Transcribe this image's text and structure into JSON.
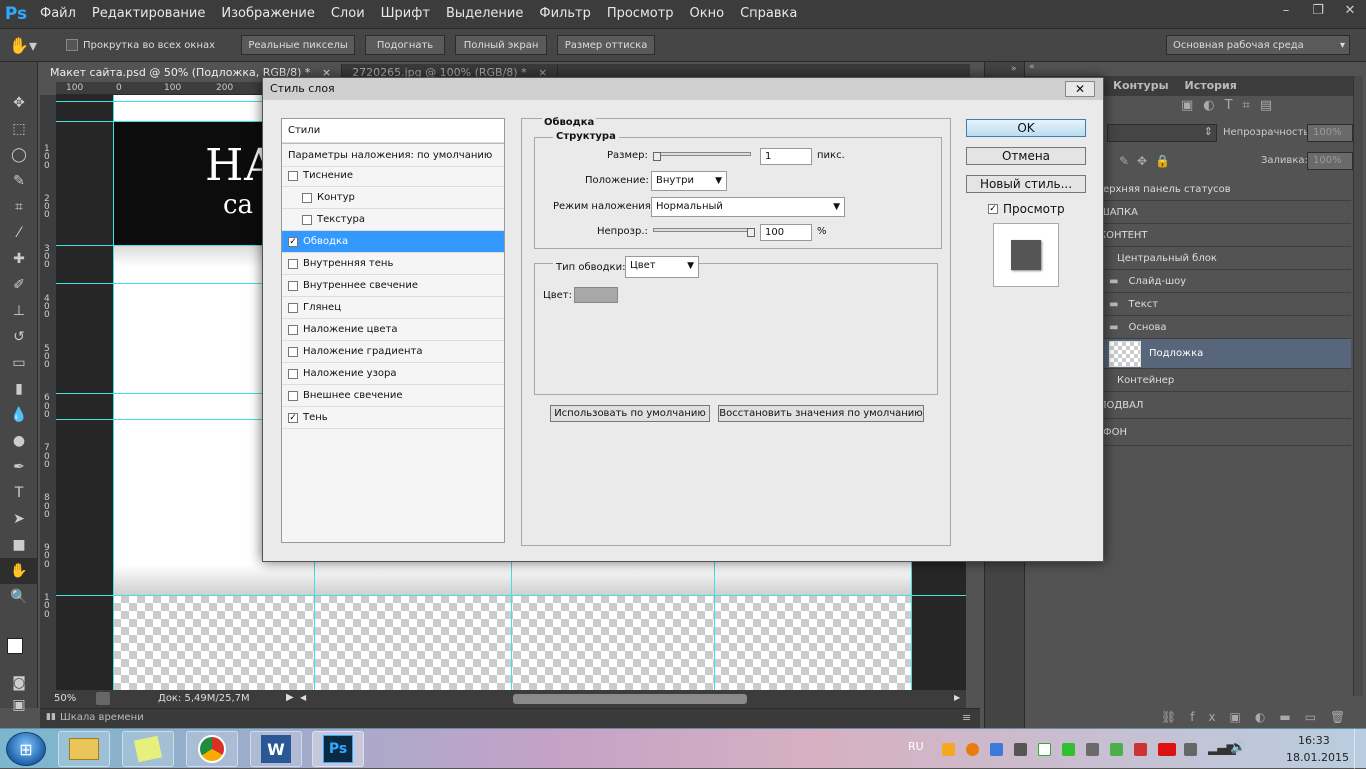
{
  "menubar": {
    "logo": "Ps",
    "items": [
      "Файл",
      "Редактирование",
      "Изображение",
      "Слои",
      "Шрифт",
      "Выделение",
      "Фильтр",
      "Просмотр",
      "Окно",
      "Справка"
    ],
    "window_controls": [
      "–",
      "❐",
      "✕"
    ]
  },
  "optionsbar": {
    "scroll_all_label": "Прокрутка во всех окнах",
    "actual_pixels": "Реальные пикселы",
    "fit": "Подогнать",
    "full_screen": "Полный экран",
    "print_size": "Размер оттиска",
    "workspace": "Основная рабочая среда"
  },
  "tools": [
    "move-icon",
    "marquee-icon",
    "lasso-icon",
    "quick-select-icon",
    "crop-icon",
    "eyedropper-icon",
    "healing-icon",
    "brush-icon",
    "stamp-icon",
    "history-brush-icon",
    "eraser-icon",
    "gradient-icon",
    "blur-icon",
    "dodge-icon",
    "pen-icon",
    "type-icon",
    "path-select-icon",
    "shape-icon",
    "hand-icon",
    "zoom-icon"
  ],
  "document": {
    "tabs": [
      "Макет сайта.psd @ 50% (Подложка, RGB/8) *",
      "2720265.jpg @ 100% (RGB/8) *"
    ],
    "ruler_h": [
      "100",
      "0",
      "100",
      "200"
    ],
    "ruler_v": [
      "1",
      "0",
      "0",
      "2",
      "0",
      "0",
      "3",
      "0",
      "0",
      "4",
      "0",
      "0",
      "5",
      "0",
      "0",
      "6",
      "0",
      "0",
      "7",
      "0",
      "0",
      "8",
      "0",
      "0",
      "9",
      "0",
      "0",
      "1",
      "0",
      "0"
    ],
    "banner_line1": "НА",
    "banner_line2": "са",
    "zoom": "50%",
    "doc_size": "Док: 5,49M/25,7M"
  },
  "timeline": {
    "label": "Шкала времени"
  },
  "panels": {
    "tabs": [
      "Контуры",
      "История"
    ],
    "opacity_label": "Непрозрачность:",
    "opacity_value": "100%",
    "fill_label": "Заливка:",
    "fill_value": "100%",
    "layers": [
      {
        "name": "ерхняя панель статусов",
        "indent": 0,
        "folder": false
      },
      {
        "name": "ШАПКА",
        "indent": 0,
        "folder": false
      },
      {
        "name": "КОНТЕНТ",
        "indent": 0,
        "folder": false
      },
      {
        "name": "Центральный блок",
        "indent": 1,
        "folder": false
      },
      {
        "name": "Слайд-шоу",
        "indent": 2,
        "folder": true
      },
      {
        "name": "Текст",
        "indent": 2,
        "folder": true
      },
      {
        "name": "Основа",
        "indent": 2,
        "folder": true
      },
      {
        "name": "Подложка",
        "indent": 3,
        "folder": false,
        "selected": true
      },
      {
        "name": "Контейнер",
        "indent": 1,
        "folder": false
      },
      {
        "name": "ПОДВАЛ",
        "indent": 0,
        "folder": false
      },
      {
        "name": "ФОН",
        "indent": 0,
        "folder": false
      }
    ]
  },
  "dialog": {
    "title": "Стиль слоя",
    "close": "✕",
    "styles_header": "Стили",
    "blending_options": "Параметры наложения: по умолчанию",
    "styles": [
      {
        "label": "Тиснение",
        "checked": false,
        "sub": false
      },
      {
        "label": "Контур",
        "checked": false,
        "sub": true
      },
      {
        "label": "Текстура",
        "checked": false,
        "sub": true
      },
      {
        "label": "Обводка",
        "checked": true,
        "sub": false,
        "selected": true
      },
      {
        "label": "Внутренняя тень",
        "checked": false,
        "sub": false
      },
      {
        "label": "Внутреннее свечение",
        "checked": false,
        "sub": false
      },
      {
        "label": "Глянец",
        "checked": false,
        "sub": false
      },
      {
        "label": "Наложение цвета",
        "checked": false,
        "sub": false
      },
      {
        "label": "Наложение градиента",
        "checked": false,
        "sub": false
      },
      {
        "label": "Наложение узора",
        "checked": false,
        "sub": false
      },
      {
        "label": "Внешнее свечение",
        "checked": false,
        "sub": false
      },
      {
        "label": "Тень",
        "checked": true,
        "sub": false
      }
    ],
    "section_title": "Обводка",
    "structure_title": "Структура",
    "size_label": "Размер:",
    "size_value": "1",
    "size_unit": "пикс.",
    "size_fraction": 0.0,
    "position_label": "Положение:",
    "position_value": "Внутри",
    "blend_label": "Режим наложения:",
    "blend_value": "Нормальный",
    "opacity_label": "Непрозр.:",
    "opacity_value": "100",
    "opacity_unit": "%",
    "opacity_fraction": 1.0,
    "fill_type_label": "Тип обводки:",
    "fill_type_value": "Цвет",
    "color_label": "Цвет:",
    "stroke_color": "#a8a8a8",
    "make_default": "Использовать по умолчанию",
    "reset_default": "Восстановить значения по умолчанию",
    "ok": "OK",
    "cancel": "Отмена",
    "new_style": "Новый стиль...",
    "preview_label": "Просмотр",
    "preview_checked": true
  },
  "taskbar": {
    "apps": [
      "explorer-icon",
      "sticky-notes-icon",
      "chrome-icon",
      "word-icon",
      "photoshop-icon"
    ],
    "word_glyph": "W",
    "ps_glyph": "Ps",
    "lang": "RU",
    "time": "16:33",
    "date": "18.01.2015"
  }
}
